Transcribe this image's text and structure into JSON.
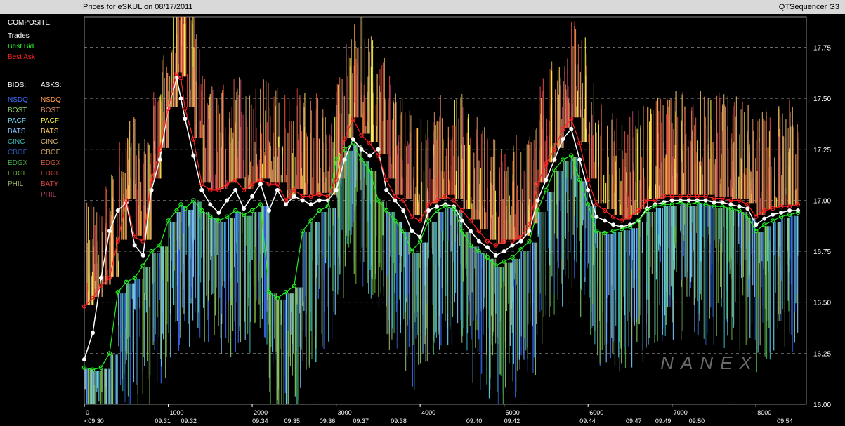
{
  "title": "Prices for  eSKUL  on  08/17/2011",
  "window_name": "QTSequencer G3",
  "legend": {
    "heading": "COMPOSITE:",
    "composite": [
      {
        "label": "Trades",
        "color": "#ffffff"
      },
      {
        "label": "Best Bid",
        "color": "#22ee22"
      },
      {
        "label": "Best Ask",
        "color": "#ff2222"
      }
    ],
    "bids_heading": "BIDS:",
    "asks_heading": "ASKS:",
    "bids": [
      {
        "label": "NSDQ",
        "color": "#3a6cff"
      },
      {
        "label": "BOST",
        "color": "#8fd06a"
      },
      {
        "label": "PACF",
        "color": "#6fe0ff"
      },
      {
        "label": "BATS",
        "color": "#8ec8ff"
      },
      {
        "label": "CINC",
        "color": "#3cb8b8"
      },
      {
        "label": "CBOE",
        "color": "#2a55b0"
      },
      {
        "label": "EDGX",
        "color": "#4fb04f"
      },
      {
        "label": "EDGE",
        "color": "#6fa83a"
      },
      {
        "label": "PHIL",
        "color": "#9ab870"
      }
    ],
    "asks": [
      {
        "label": "NSDQ",
        "color": "#ff9b4a"
      },
      {
        "label": "BOST",
        "color": "#d88860"
      },
      {
        "label": "PACF",
        "color": "#ffff40"
      },
      {
        "label": "BATS",
        "color": "#ffd060"
      },
      {
        "label": "CINC",
        "color": "#d8b070"
      },
      {
        "label": "CBOE",
        "color": "#c8a060"
      },
      {
        "label": "EDGX",
        "color": "#d06040"
      },
      {
        "label": "EDGE",
        "color": "#c04030"
      },
      {
        "label": "BATY",
        "color": "#e04848"
      },
      {
        "label": "PHIL",
        "color": "#b04060"
      }
    ]
  },
  "watermark": "NANEX",
  "chart_data": {
    "type": "line",
    "xlim": [
      0,
      8600
    ],
    "ylim": [
      16.0,
      17.9
    ],
    "y_ticks": [
      "16.00",
      "16.25",
      "16.50",
      "16.75",
      "17.00",
      "17.25",
      "17.50",
      "17.75"
    ],
    "x_ticks": [
      "0",
      "1000",
      "2000",
      "3000",
      "4000",
      "5000",
      "6000",
      "7000",
      "8000"
    ],
    "time_ticks": [
      {
        "x": 0,
        "label": "<09:30"
      },
      {
        "x": 840,
        "label": "09:31"
      },
      {
        "x": 1150,
        "label": "09:32"
      },
      {
        "x": 2000,
        "label": "09:34"
      },
      {
        "x": 2380,
        "label": "09:35"
      },
      {
        "x": 2800,
        "label": "09:36"
      },
      {
        "x": 3200,
        "label": "09:37"
      },
      {
        "x": 3650,
        "label": "09:38"
      },
      {
        "x": 4550,
        "label": "09:40"
      },
      {
        "x": 5000,
        "label": "09:42"
      },
      {
        "x": 5900,
        "label": "09:44"
      },
      {
        "x": 6450,
        "label": "09:47"
      },
      {
        "x": 6800,
        "label": "09:49"
      },
      {
        "x": 7200,
        "label": "09:50"
      },
      {
        "x": 8250,
        "label": "09:54"
      }
    ],
    "grid": true,
    "series": [
      {
        "name": "Trades",
        "color": "#ffffff",
        "x": [
          0,
          100,
          200,
          300,
          400,
          500,
          600,
          700,
          800,
          900,
          1000,
          1100,
          1150,
          1200,
          1300,
          1400,
          1500,
          1600,
          1700,
          1800,
          1900,
          2000,
          2100,
          2200,
          2300,
          2400,
          2500,
          2600,
          2700,
          2800,
          2900,
          3000,
          3100,
          3200,
          3300,
          3400,
          3500,
          3600,
          3700,
          3800,
          3900,
          4000,
          4100,
          4200,
          4300,
          4400,
          4500,
          4600,
          4700,
          4800,
          4900,
          5000,
          5100,
          5200,
          5300,
          5400,
          5500,
          5600,
          5700,
          5800,
          5900,
          6000,
          6100,
          6200,
          6300,
          6400,
          6500,
          6600,
          6700,
          6800,
          6900,
          7000,
          7100,
          7200,
          7300,
          7400,
          7500,
          7600,
          7700,
          7800,
          7900,
          8000,
          8100,
          8200,
          8300,
          8400,
          8500
        ],
        "y": [
          16.22,
          16.35,
          16.62,
          16.85,
          16.95,
          16.99,
          16.78,
          16.73,
          17.05,
          17.2,
          17.45,
          17.6,
          17.5,
          17.4,
          17.22,
          17.05,
          16.98,
          16.94,
          17.0,
          17.05,
          16.96,
          17.02,
          17.08,
          16.95,
          17.05,
          16.98,
          17.02,
          17.0,
          16.98,
          17.0,
          17.0,
          17.05,
          17.2,
          17.3,
          17.25,
          17.22,
          17.25,
          17.05,
          17.0,
          16.95,
          16.85,
          16.82,
          16.95,
          16.97,
          16.98,
          16.97,
          16.9,
          16.85,
          16.8,
          16.77,
          16.73,
          16.75,
          16.78,
          16.8,
          16.85,
          17.0,
          17.1,
          17.2,
          17.3,
          17.35,
          17.2,
          17.05,
          16.92,
          16.9,
          16.88,
          16.87,
          16.88,
          16.9,
          16.96,
          16.98,
          16.99,
          17.0,
          17.0,
          17.0,
          17.0,
          17.0,
          16.99,
          16.99,
          16.98,
          16.97,
          16.96,
          16.88,
          16.91,
          16.93,
          16.94,
          16.95,
          16.95
        ]
      },
      {
        "name": "Best Bid",
        "color": "#22ee22",
        "x": [
          0,
          100,
          200,
          300,
          400,
          500,
          600,
          700,
          800,
          900,
          1000,
          1100,
          1150,
          1200,
          1300,
          1400,
          1500,
          1600,
          1700,
          1800,
          1900,
          2000,
          2100,
          2200,
          2300,
          2400,
          2500,
          2600,
          2700,
          2800,
          2900,
          3000,
          3100,
          3200,
          3300,
          3400,
          3500,
          3600,
          3700,
          3800,
          3900,
          4000,
          4100,
          4200,
          4300,
          4400,
          4500,
          4600,
          4700,
          4800,
          4900,
          5000,
          5100,
          5200,
          5300,
          5400,
          5500,
          5600,
          5700,
          5800,
          5900,
          6000,
          6100,
          6200,
          6300,
          6400,
          6500,
          6600,
          6700,
          6800,
          6900,
          7000,
          7100,
          7200,
          7300,
          7400,
          7500,
          7600,
          7700,
          7800,
          7900,
          8000,
          8100,
          8200,
          8300,
          8400,
          8500
        ],
        "y": [
          16.18,
          16.17,
          16.18,
          16.25,
          16.55,
          16.6,
          16.62,
          16.68,
          16.75,
          16.78,
          16.9,
          16.95,
          16.98,
          16.96,
          17.0,
          16.95,
          16.92,
          16.9,
          16.92,
          16.95,
          16.93,
          16.95,
          16.98,
          16.55,
          16.52,
          16.55,
          16.58,
          16.85,
          16.9,
          16.95,
          16.97,
          17.2,
          17.25,
          17.28,
          17.2,
          17.15,
          17.0,
          16.95,
          16.9,
          16.85,
          16.75,
          16.8,
          16.9,
          16.95,
          16.97,
          16.96,
          16.85,
          16.78,
          16.75,
          16.72,
          16.68,
          16.7,
          16.72,
          16.76,
          16.8,
          16.95,
          17.05,
          17.15,
          17.2,
          17.22,
          17.1,
          16.98,
          16.85,
          16.84,
          16.85,
          16.86,
          16.87,
          16.9,
          16.95,
          16.97,
          16.98,
          16.98,
          16.99,
          16.98,
          16.99,
          16.98,
          16.97,
          16.97,
          16.96,
          16.95,
          16.92,
          16.85,
          16.88,
          16.9,
          16.92,
          16.93,
          16.94
        ]
      },
      {
        "name": "Best Ask",
        "color": "#ff2222",
        "x": [
          0,
          100,
          200,
          300,
          400,
          500,
          600,
          700,
          800,
          900,
          1000,
          1100,
          1150,
          1200,
          1300,
          1400,
          1500,
          1600,
          1700,
          1800,
          1900,
          2000,
          2100,
          2200,
          2300,
          2400,
          2500,
          2600,
          2700,
          2800,
          2900,
          3000,
          3100,
          3200,
          3300,
          3400,
          3500,
          3600,
          3700,
          3800,
          3900,
          4000,
          4100,
          4200,
          4300,
          4400,
          4500,
          4600,
          4700,
          4800,
          4900,
          5000,
          5100,
          5200,
          5300,
          5400,
          5500,
          5600,
          5700,
          5800,
          5900,
          6000,
          6100,
          6200,
          6300,
          6400,
          6500,
          6600,
          6700,
          6800,
          6900,
          7000,
          7100,
          7200,
          7300,
          7400,
          7500,
          7600,
          7700,
          7800,
          7900,
          8000,
          8100,
          8200,
          8300,
          8400,
          8500
        ],
        "y": [
          16.48,
          16.52,
          16.58,
          16.62,
          16.8,
          17.0,
          16.82,
          16.8,
          17.1,
          17.25,
          17.45,
          17.62,
          17.6,
          17.45,
          17.3,
          17.08,
          17.05,
          17.05,
          17.08,
          17.1,
          17.05,
          17.08,
          17.1,
          17.08,
          17.08,
          17.0,
          17.05,
          17.02,
          17.02,
          17.03,
          17.02,
          17.1,
          17.3,
          17.4,
          17.32,
          17.28,
          17.22,
          17.1,
          17.02,
          17.0,
          16.92,
          16.9,
          16.98,
          17.0,
          17.02,
          17.0,
          16.95,
          16.9,
          16.85,
          16.8,
          16.78,
          16.8,
          16.8,
          16.82,
          16.88,
          17.08,
          17.18,
          17.25,
          17.35,
          17.4,
          17.28,
          17.1,
          16.98,
          16.95,
          16.92,
          16.9,
          16.92,
          16.95,
          17.0,
          17.0,
          17.02,
          17.02,
          17.02,
          17.02,
          17.02,
          17.02,
          17.01,
          17.01,
          17.0,
          17.0,
          16.98,
          16.92,
          16.95,
          16.96,
          16.97,
          16.97,
          16.98
        ]
      }
    ]
  }
}
